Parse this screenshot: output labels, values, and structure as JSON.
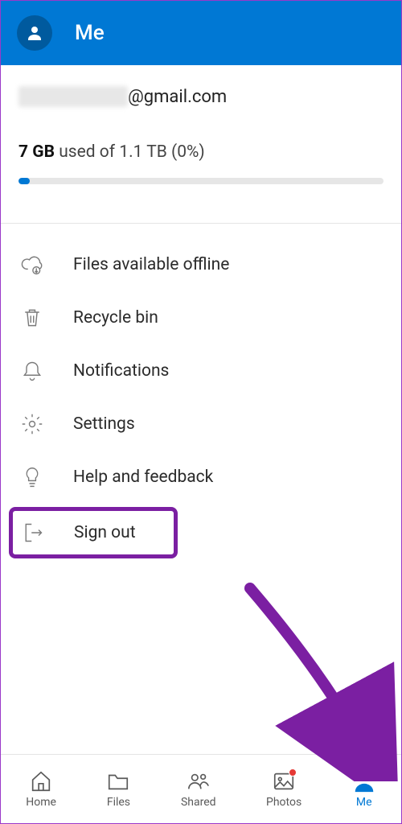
{
  "header": {
    "title": "Me"
  },
  "account": {
    "email_domain": "@gmail.com",
    "storage_used": "7 GB",
    "storage_text": " used of 1.1 TB (0%)",
    "storage_percent": 0
  },
  "menu": {
    "offline": "Files available offline",
    "recycle": "Recycle bin",
    "notifications": "Notifications",
    "settings": "Settings",
    "help": "Help and feedback",
    "signout": "Sign out"
  },
  "nav": {
    "home": "Home",
    "files": "Files",
    "shared": "Shared",
    "photos": "Photos",
    "me": "Me"
  },
  "colors": {
    "primary": "#0078d4",
    "highlight": "#7b1fa2",
    "badge": "#e53935"
  }
}
